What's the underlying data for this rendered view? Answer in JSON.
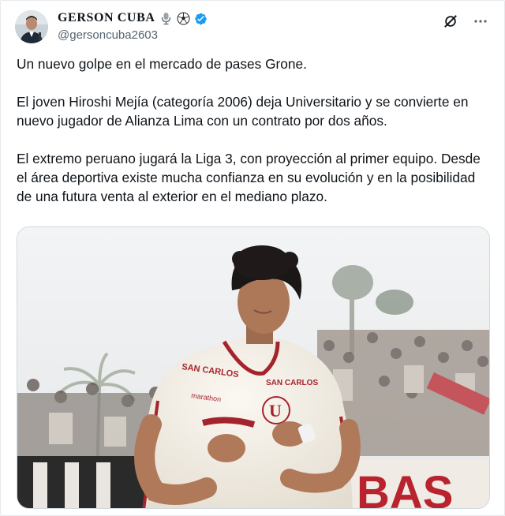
{
  "author": {
    "display_name": "GERSON CUBA",
    "handle": "@gersoncuba2603",
    "name_emojis": [
      "microphone-icon",
      "soccer-ball-icon"
    ],
    "verified": true,
    "verified_color": "#1d9bf0"
  },
  "tweet": {
    "paragraphs": [
      "Un nuevo golpe en el mercado de pases Grone.",
      "El joven Hiroshi Mejía (categoría 2006) deja Universitario y se convierte en nuevo jugador de Alianza Lima con un contrato por dos años.",
      "El extremo peruano jugará la Liga 3, con proyección al primer equipo. Desde el área deportiva existe mucha confianza en su evolución y en la posibilidad de una futura venta al exterior en el mediano plazo."
    ]
  },
  "media": {
    "jersey_texts": [
      "SAN CARLOS",
      "SAN CARLOS",
      "marathon",
      "U"
    ],
    "banner_text": "BAS",
    "colors": {
      "jersey": "#f4efe6",
      "club_red": "#a5232d",
      "sky": "#eef0f1"
    }
  },
  "actions": {
    "grok_icon": "grok-icon",
    "more_icon": "more-icon"
  }
}
